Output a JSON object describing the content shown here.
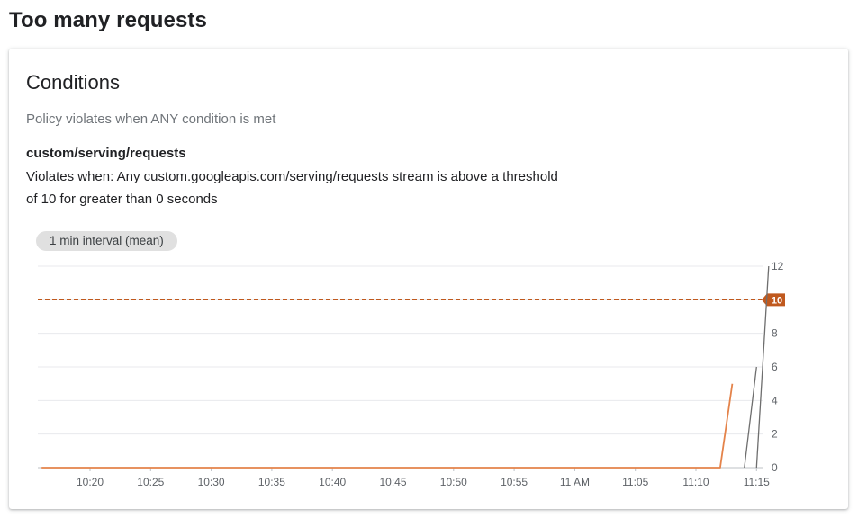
{
  "page": {
    "title": "Too many requests"
  },
  "card": {
    "title": "Conditions",
    "policy_text": "Policy violates when ANY condition is met",
    "metric_name": "custom/serving/requests",
    "condition_description": "Violates when: Any custom.googleapis.com/serving/requests stream is above a threshold of 10 for greater than 0 seconds",
    "interval_chip": "1 min interval (mean)"
  },
  "colors": {
    "threshold": "#c0591e",
    "series_orange": "#e4834a",
    "series_gray": "#6e6e6e",
    "grid": "#e8eaed"
  },
  "chart_data": {
    "type": "line",
    "x_ticks": [
      "10:20",
      "10:25",
      "10:30",
      "10:35",
      "10:40",
      "10:45",
      "10:50",
      "10:55",
      "11 AM",
      "11:05",
      "11:10",
      "11:15"
    ],
    "y_ticks": [
      "0",
      "2",
      "4",
      "6",
      "8",
      "12"
    ],
    "ylim": [
      0,
      12
    ],
    "threshold": {
      "value": 10,
      "label": "10"
    },
    "series": [
      {
        "color": "orange",
        "points": [
          [
            "10:16",
            0
          ],
          [
            "11:12",
            0
          ],
          [
            "11:13",
            5
          ]
        ]
      },
      {
        "color": "gray",
        "points": [
          [
            "11:14",
            0
          ],
          [
            "11:15",
            6
          ]
        ]
      },
      {
        "color": "gray",
        "points": [
          [
            "11:15",
            0
          ],
          [
            "11:16",
            12
          ]
        ]
      }
    ]
  }
}
